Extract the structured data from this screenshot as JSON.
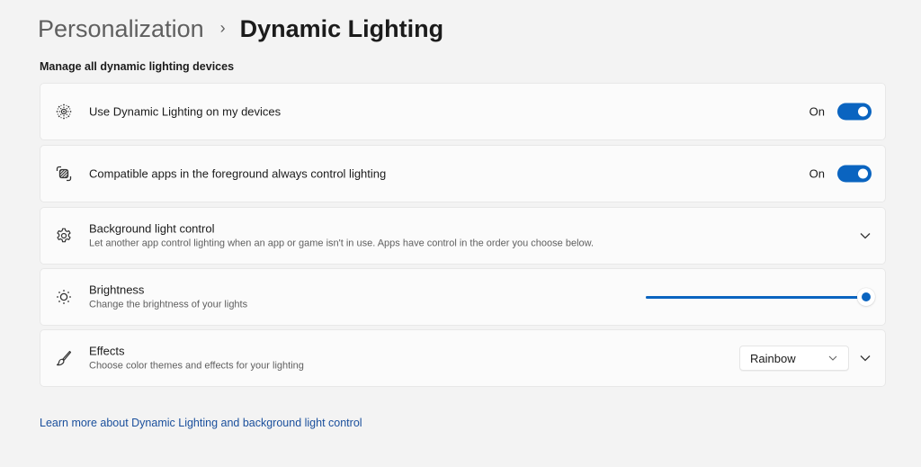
{
  "breadcrumb": {
    "parent": "Personalization",
    "separator": "›",
    "current": "Dynamic Lighting"
  },
  "section_title": "Manage all dynamic lighting devices",
  "settings": {
    "use_dynamic_lighting": {
      "icon": "dynamic-lighting-icon",
      "title": "Use Dynamic Lighting on my devices",
      "state_label": "On",
      "enabled": true
    },
    "foreground_control": {
      "icon": "apps-overlap-icon",
      "title": "Compatible apps in the foreground always control lighting",
      "state_label": "On",
      "enabled": true
    },
    "background_control": {
      "icon": "gear-icon",
      "title": "Background light control",
      "description": "Let another app control lighting when an app or game isn't in use. Apps have control in the order you choose below.",
      "expanded": false
    },
    "brightness": {
      "icon": "sun-icon",
      "title": "Brightness",
      "description": "Change the brightness of your lights",
      "value_percent": 100
    },
    "effects": {
      "icon": "paintbrush-icon",
      "title": "Effects",
      "description": "Choose color themes and effects for your lighting",
      "selected": "Rainbow",
      "expanded": false
    }
  },
  "learn_more_link": "Learn more about Dynamic Lighting and background light control",
  "colors": {
    "accent": "#0a64c0",
    "background": "#f3f3f3",
    "card": "#fbfbfb",
    "link": "#1a4f9c"
  }
}
